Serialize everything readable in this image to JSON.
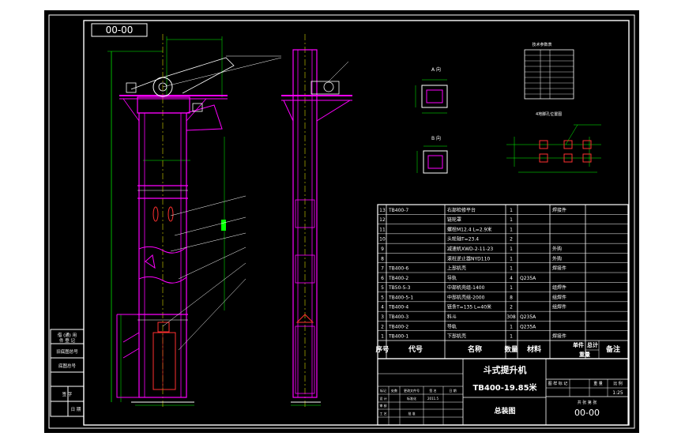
{
  "drawing": {
    "drawing_number": "00-00",
    "machine_name": "斗式提升机",
    "model": "TB400-19.85米",
    "view_title": "总装图",
    "scale": "1:25",
    "labels": {
      "view_a": "A 向",
      "view_b": "B 向",
      "anchor_layout": "4地脚孔位置图",
      "tech_table_title": "技术参数表"
    }
  },
  "bom": {
    "headers": {
      "no": "序号",
      "code": "代号",
      "name": "名称",
      "qty": "数量",
      "material": "材料",
      "unit_weight": "单件",
      "total_weight": "总计",
      "weight": "重量",
      "remark": "备注"
    },
    "rows": [
      {
        "no": "13",
        "code": "TB400-7",
        "name": "右部检修平台",
        "qty": "1",
        "material": "",
        "remark": "焊接件"
      },
      {
        "no": "12",
        "code": "",
        "name": "链轮罩",
        "qty": "1",
        "material": "",
        "remark": ""
      },
      {
        "no": "11",
        "code": "",
        "name": "螺栓M12.4 L=2.9米",
        "qty": "1",
        "material": "",
        "remark": ""
      },
      {
        "no": "10",
        "code": "",
        "name": "头轮轴T=23.4",
        "qty": "2",
        "material": "",
        "remark": ""
      },
      {
        "no": "9",
        "code": "",
        "name": "减速机XWD-2-11-23",
        "qty": "1",
        "material": "",
        "remark": "外购"
      },
      {
        "no": "8",
        "code": "",
        "name": "滚柱逆止器NYD110",
        "qty": "1",
        "material": "",
        "remark": "外购"
      },
      {
        "no": "7",
        "code": "TB400-6",
        "name": "上部机壳",
        "qty": "1",
        "material": "",
        "remark": "焊接件"
      },
      {
        "no": "6",
        "code": "TB400-2",
        "name": "导轨",
        "qty": "4",
        "material": "Q235A",
        "remark": ""
      },
      {
        "no": "5",
        "code": "TB50-5-3",
        "name": "中部机壳组-1400",
        "qty": "1",
        "material": "",
        "remark": "组焊件"
      },
      {
        "no": "5",
        "code": "TB400-5-1",
        "name": "中部机壳组-2000",
        "qty": "8",
        "material": "",
        "remark": "组焊件"
      },
      {
        "no": "4",
        "code": "TB400-4",
        "name": "链条T=135 L=40米",
        "qty": "2",
        "material": "",
        "remark": "组焊件"
      },
      {
        "no": "3",
        "code": "TB400-3",
        "name": "料斗",
        "qty": "308",
        "material": "Q235A",
        "remark": ""
      },
      {
        "no": "2",
        "code": "TB400-2",
        "name": "导轨",
        "qty": "1",
        "material": "Q235A",
        "remark": ""
      },
      {
        "no": "1",
        "code": "TB400-1",
        "name": "下部机壳",
        "qty": "1",
        "material": "",
        "remark": "焊接件"
      }
    ]
  },
  "side_block": {
    "items": [
      "借 (通) 用",
      "件 登 记",
      "旧底图总号",
      "底图总号",
      "签 字",
      "日 期"
    ]
  },
  "title_block": {
    "stage_labels": [
      "图 样 标 记",
      "重 量",
      "比 例"
    ],
    "sheet": "共 张  第 张",
    "signatures": [
      "标记",
      "处数",
      "更改文件号",
      "签 名",
      "日 期",
      "设 计",
      "标准化",
      "审 核",
      "工 艺",
      "批 准"
    ],
    "date_code": "2011.5"
  },
  "colors": {
    "background": "#000000",
    "frame": "#ffffff",
    "elevator": "#ff00ff",
    "dimension": "#00ff00",
    "centerline": "#ffff00",
    "highlight": "#ff3030",
    "cyan": "#00e5ff"
  }
}
